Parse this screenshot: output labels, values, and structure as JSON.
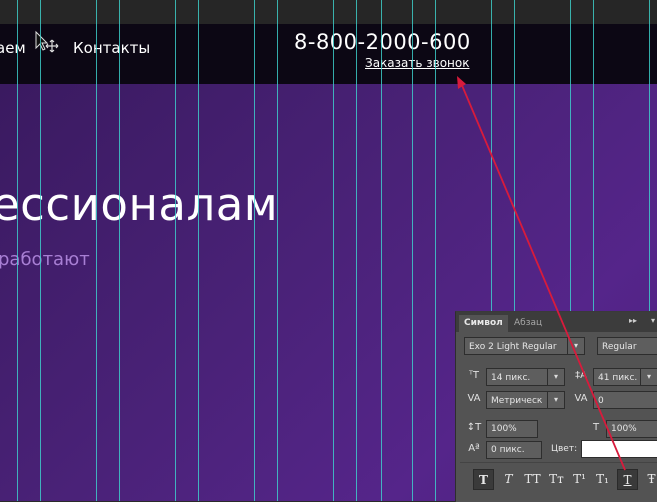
{
  "header": {
    "nav_partial": "аем",
    "nav_contacts": "Контакты",
    "phone": "8-800-2000-600",
    "callback_link": "Заказать звонок"
  },
  "hero": {
    "title_partial": "ессионалам",
    "subtitle_partial": "работают"
  },
  "colors": {
    "header_bg": "#0c0714",
    "hero_bg": "#4a2278",
    "guide": "#3fd6d0",
    "arrow": "#d81b3c",
    "subtitle": "#a87fd4"
  },
  "panel": {
    "tab_active": "Символ",
    "tab_inactive": "Абзац",
    "font_family": "Exo 2 Light Regular",
    "font_style": "Regular",
    "font_size": "14 пикс.",
    "leading": "41 пикс.",
    "kerning": "Метрическ",
    "tracking": "0",
    "vertical_scale": "100%",
    "horizontal_scale": "100%",
    "baseline_shift": "0 пикс.",
    "color_label": "Цвет:",
    "style_buttons": [
      "T",
      "T",
      "TT",
      "Tт",
      "T¹",
      "T₁",
      "T",
      "Ŧ"
    ]
  }
}
